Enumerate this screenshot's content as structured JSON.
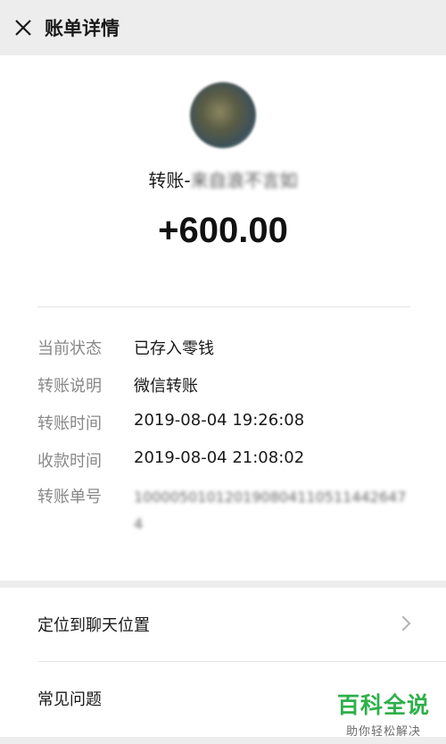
{
  "header": {
    "close_icon": "close-icon",
    "title": "账单详情"
  },
  "transaction": {
    "label_prefix": "转账-",
    "from_name": "来自浪不言如",
    "amount": "+600.00"
  },
  "details": [
    {
      "label": "当前状态",
      "value": "已存入零钱"
    },
    {
      "label": "转账说明",
      "value": "微信转账"
    },
    {
      "label": "转账时间",
      "value": "2019-08-04 19:26:08"
    },
    {
      "label": "收款时间",
      "value": "2019-08-04 21:08:02"
    },
    {
      "label": "转账单号",
      "value": "1000050101201908041105114426474"
    }
  ],
  "actions": [
    {
      "label": "定位到聊天位置",
      "icon": "chevron-right-icon"
    },
    {
      "label": "常见问题"
    }
  ],
  "watermark": {
    "title": "百科全说",
    "subtitle": "助你轻松解决"
  },
  "colors": {
    "background": "#ededed",
    "card": "#ffffff",
    "label_gray": "#888888",
    "watermark_green": "#2db04a"
  }
}
